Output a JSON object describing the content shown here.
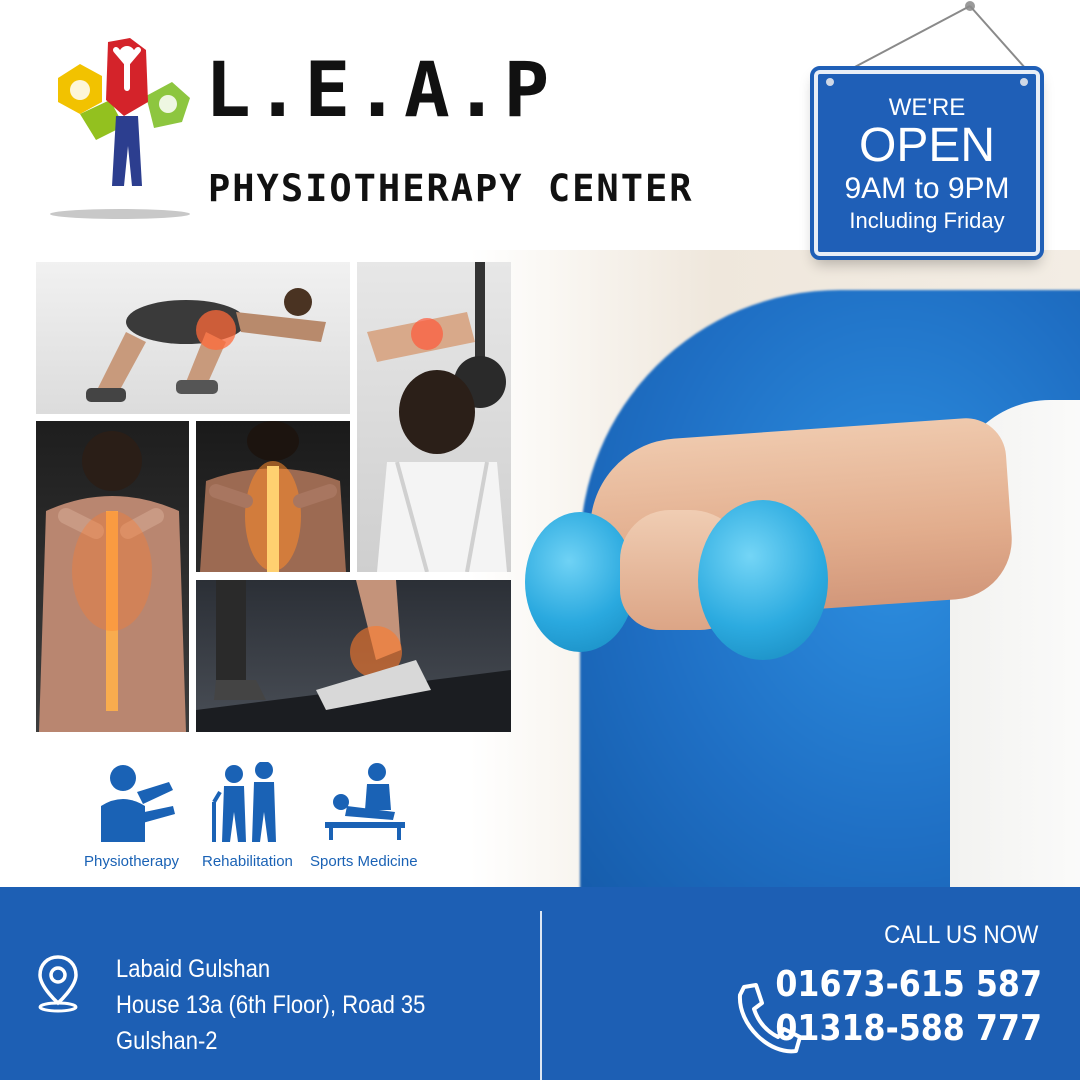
{
  "brand": {
    "title": "L.E.A.P",
    "subtitle": "PHYSIOTHERAPY CENTER"
  },
  "open_sign": {
    "line1": "WE'RE",
    "line2": "OPEN",
    "line3": "9AM to 9PM",
    "line4": "Including Friday"
  },
  "services": [
    {
      "label": "Physiotherapy",
      "icon": "physiotherapy-icon"
    },
    {
      "label": "Rehabilitation",
      "icon": "rehabilitation-icon"
    },
    {
      "label": "Sports Medicine",
      "icon": "sports-medicine-icon"
    }
  ],
  "address": {
    "line1": "Labaid Gulshan",
    "line2": "House 13a (6th Floor), Road 35",
    "line3": "Gulshan-2"
  },
  "contact": {
    "call_label": "CALL US NOW",
    "phone1": "01673-615 587",
    "phone2": "01318-588 777"
  },
  "colors": {
    "brand_blue": "#1d5fb4",
    "service_blue": "#1a62b5",
    "dumbbell": "#35b5e6"
  }
}
